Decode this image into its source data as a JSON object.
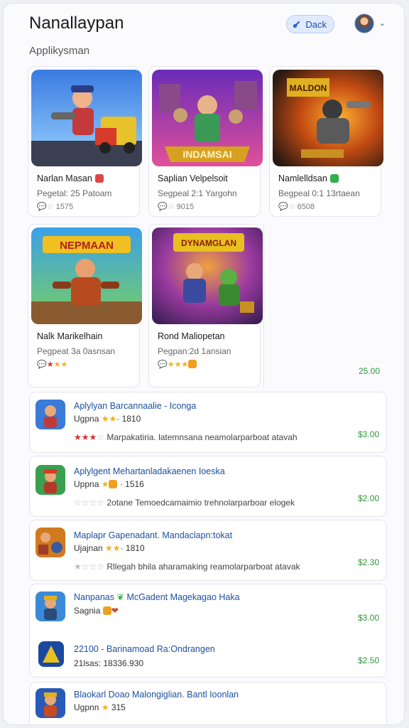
{
  "header": {
    "title": "Nanallaypan",
    "deck_label": "Dack",
    "icons": [
      "link-icon",
      "avatar",
      "chevron-down-icon"
    ]
  },
  "section": {
    "title": "Applikysman"
  },
  "cards": [
    {
      "name": "Narlan Masan",
      "meta": "Pegetal: 25 Patoam",
      "stat": "1575",
      "badge": "red"
    },
    {
      "name": "Saplian Velpelsoit",
      "meta": "Segpeal 2:1 Yargohn",
      "stat": "9015",
      "art_text": "INDAMSAI"
    },
    {
      "name": "Namlelldsan",
      "meta": "Begpeal 0:1 13rtaean",
      "stat": "6508",
      "badge": "green",
      "art_text": "MALDON"
    },
    {
      "name": "Nalk Marikelhain",
      "meta": "Pegpeat 3a 0asnsan",
      "stat": "",
      "art_text": "NEPMAAN"
    },
    {
      "name": "Rond Maliopetan",
      "meta": "Pegpan:2d 1ansian",
      "stat": "",
      "art_text": "DYNAMGLAN"
    }
  ],
  "featured_price": "25.00",
  "list": [
    {
      "title": "Aplylyan Barcannaalie - Iconga",
      "sub": "Ugpna",
      "sub_count": "1810",
      "desc": "Marpakatiria. latemnsana neamolarparboat atavah",
      "price": "$3.00"
    },
    {
      "title": "Aplylgent Mehartanladakaenen Ioeska",
      "sub": "Uppna",
      "sub_count": "1516",
      "desc": "2otane Temoedcamaimio trehnolarparboar elogek",
      "price": "$2.00"
    },
    {
      "title": "Maplapr Gapenadant. Mandaclapn:tokat",
      "sub": "Ujajnan",
      "sub_count": "1810",
      "desc": "Rllegah bhila aharamaking reamolarparboat atavak",
      "price": "$2.30"
    },
    {
      "title": "Nanpanas",
      "title_extra": "McGadent Magekagao Haka",
      "sub": "Sagnia",
      "sub_count": "",
      "desc": "",
      "price": "$3.00"
    },
    {
      "title": "22100 - Barinamoad Ra:Ondrangen",
      "sub": "21lsas: 18336.930",
      "sub_count": "",
      "desc": "",
      "price": "$2.50"
    },
    {
      "title": "Blaokarl Doao Malongiglian. Bantl Ioonlan",
      "sub": "Ugpnn",
      "sub_count": "315",
      "desc": "",
      "price": ""
    }
  ],
  "card_stat_prefix": "1575",
  "row4_meta": "21lsas: 18336.930",
  "colors": {
    "accent": "#1f4ea6",
    "price": "#2c9a3a",
    "link": "#1d4f9e"
  }
}
